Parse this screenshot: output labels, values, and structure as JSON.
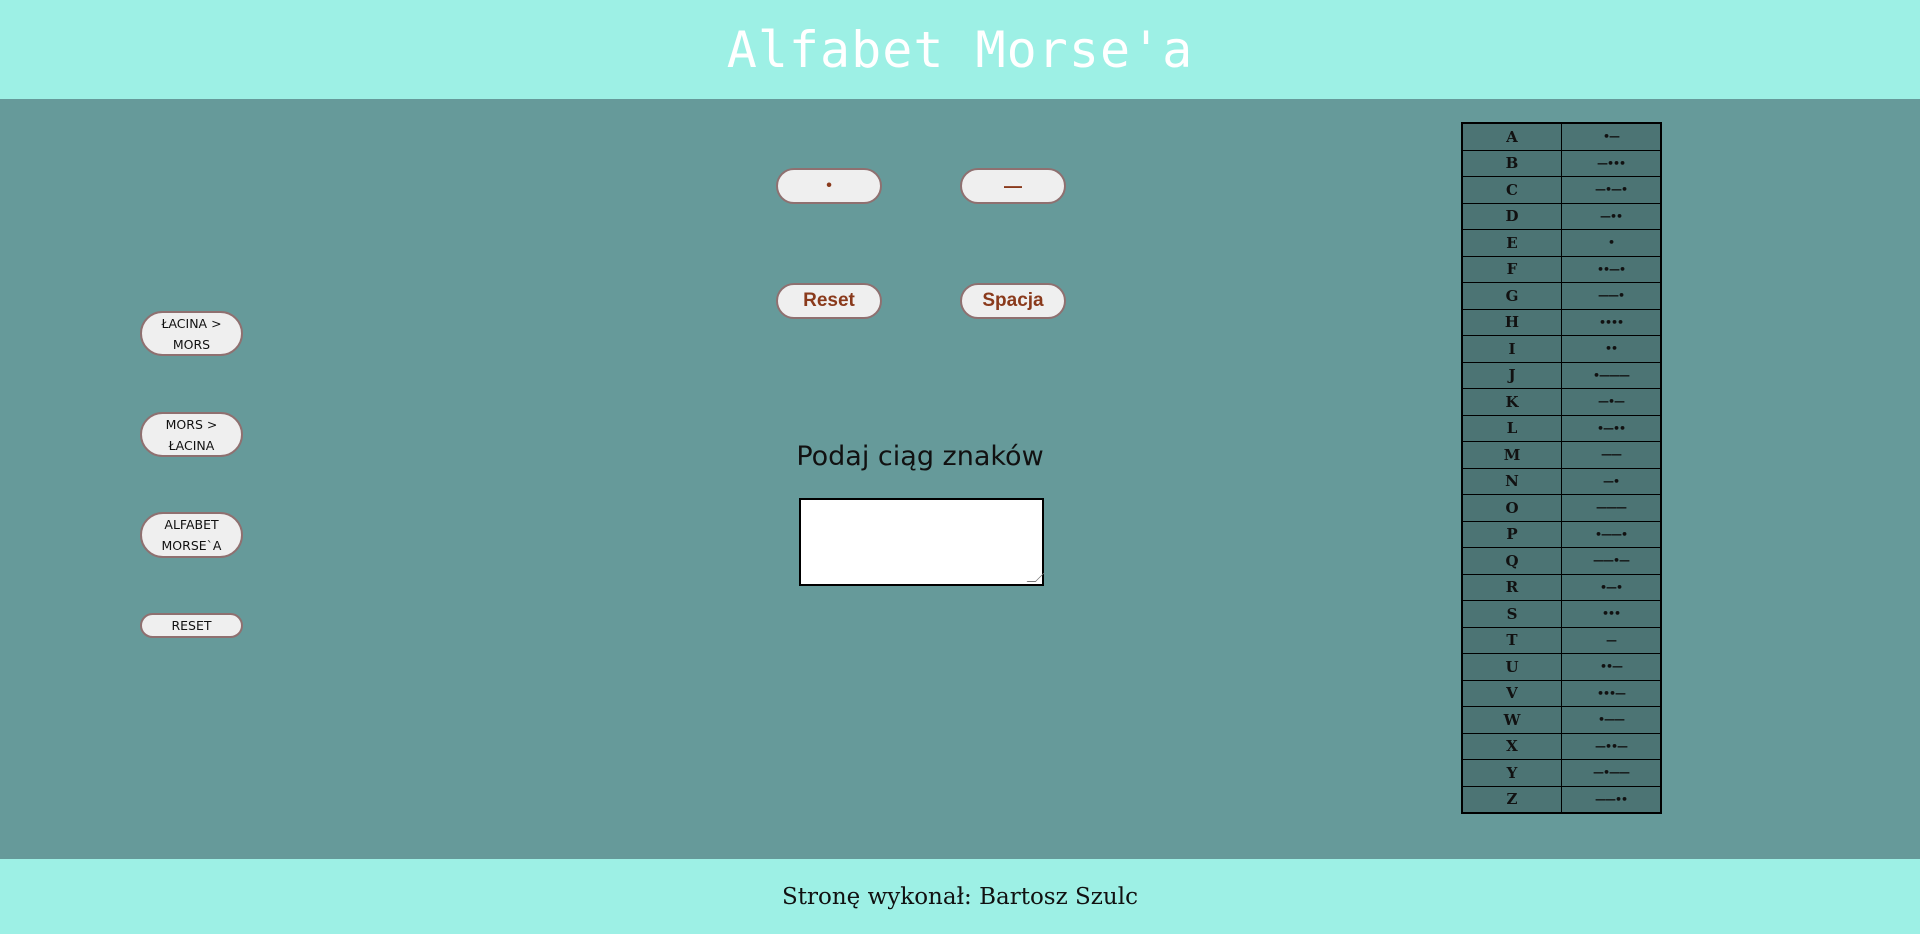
{
  "header": {
    "title": "Alfabet Morse'a"
  },
  "side_nav": [
    {
      "label": "ŁACINA > MORS"
    },
    {
      "label": "MORS > ŁACINA"
    },
    {
      "label": "ALFABET MORSE`A"
    },
    {
      "label": "RESET"
    }
  ],
  "keypad": {
    "dot_label": "•",
    "dash_label": "—",
    "reset_label": "Reset",
    "space_label": "Spacja"
  },
  "input": {
    "prompt": "Podaj ciąg znaków",
    "value": ""
  },
  "morse_table": [
    {
      "letter": "A",
      "code": "•—"
    },
    {
      "letter": "B",
      "code": "—•••"
    },
    {
      "letter": "C",
      "code": "—•—•"
    },
    {
      "letter": "D",
      "code": "—••"
    },
    {
      "letter": "E",
      "code": "•"
    },
    {
      "letter": "F",
      "code": "••—•"
    },
    {
      "letter": "G",
      "code": "——•"
    },
    {
      "letter": "H",
      "code": "••••"
    },
    {
      "letter": "I",
      "code": "••"
    },
    {
      "letter": "J",
      "code": "•———"
    },
    {
      "letter": "K",
      "code": "—•—"
    },
    {
      "letter": "L",
      "code": "•—••"
    },
    {
      "letter": "M",
      "code": "——"
    },
    {
      "letter": "N",
      "code": "—•"
    },
    {
      "letter": "O",
      "code": "———"
    },
    {
      "letter": "P",
      "code": "•——•"
    },
    {
      "letter": "Q",
      "code": "——•—"
    },
    {
      "letter": "R",
      "code": "•—•"
    },
    {
      "letter": "S",
      "code": "•••"
    },
    {
      "letter": "T",
      "code": "—"
    },
    {
      "letter": "U",
      "code": "••—"
    },
    {
      "letter": "V",
      "code": "•••—"
    },
    {
      "letter": "W",
      "code": "•——"
    },
    {
      "letter": "X",
      "code": "—••—"
    },
    {
      "letter": "Y",
      "code": "—•——"
    },
    {
      "letter": "Z",
      "code": "——••"
    }
  ],
  "footer": {
    "credit": "Stronę wykonał: Bartosz Szulc"
  }
}
